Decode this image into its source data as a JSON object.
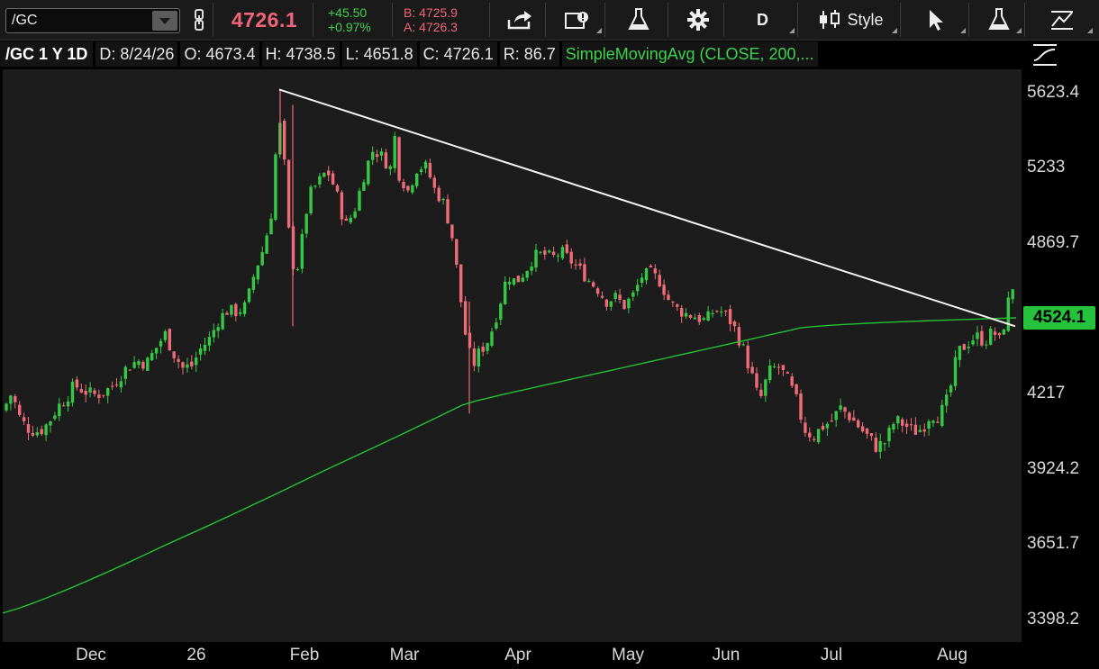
{
  "toolbar": {
    "symbol": "/GC",
    "last_price": "4726.1",
    "change": "+45.50",
    "change_pct": "+0.97%",
    "bid": "B: 4725.9",
    "ask": "A: 4726.3",
    "period_button": "D",
    "style_button": "Style"
  },
  "infobar": {
    "symbol_period": "/GC 1 Y 1D",
    "date": "D: 8/24/26",
    "open": "O: 4673.4",
    "high": "H: 4738.5",
    "low": "L: 4651.8",
    "close": "C: 4726.1",
    "range": "R: 86.7",
    "study": "SimpleMovingAvg (CLOSE, 200,..."
  },
  "chart_data": {
    "type": "candlestick",
    "overlays": [
      "SimpleMovingAvg (CLOSE, 200)",
      "trendline"
    ],
    "y_ticks": [
      "5623.4",
      "5233",
      "4869.7",
      "4524.1",
      "4217",
      "3924.2",
      "3651.7",
      "3398.2"
    ],
    "x_ticks": [
      "Dec",
      "26",
      "Feb",
      "Mar",
      "Apr",
      "May",
      "Jun",
      "Jul",
      "Aug"
    ],
    "current_sma_value": "4524.1",
    "trendline": {
      "from": [
        "Jan 28",
        5640
      ],
      "to": [
        "Aug 24",
        4490
      ]
    },
    "candles_close_path": [
      [
        0,
        4150
      ],
      [
        10,
        4220
      ],
      [
        20,
        4110
      ],
      [
        30,
        4080
      ],
      [
        40,
        4070
      ],
      [
        50,
        4100
      ],
      [
        60,
        4160
      ],
      [
        70,
        4200
      ],
      [
        80,
        4250
      ],
      [
        90,
        4230
      ],
      [
        100,
        4210
      ],
      [
        110,
        4220
      ],
      [
        120,
        4240
      ],
      [
        130,
        4290
      ],
      [
        140,
        4330
      ],
      [
        150,
        4350
      ],
      [
        160,
        4340
      ],
      [
        170,
        4400
      ],
      [
        180,
        4460
      ],
      [
        190,
        4380
      ],
      [
        200,
        4320
      ],
      [
        210,
        4330
      ],
      [
        220,
        4400
      ],
      [
        230,
        4440
      ],
      [
        240,
        4520
      ],
      [
        250,
        4560
      ],
      [
        260,
        4550
      ],
      [
        270,
        4580
      ],
      [
        280,
        4740
      ],
      [
        290,
        4850
      ],
      [
        300,
        5050
      ],
      [
        305,
        5480
      ],
      [
        310,
        5430
      ],
      [
        318,
        4900
      ],
      [
        325,
        4700
      ],
      [
        332,
        4880
      ],
      [
        340,
        5100
      ],
      [
        350,
        5160
      ],
      [
        360,
        5220
      ],
      [
        370,
        5120
      ],
      [
        380,
        4950
      ],
      [
        390,
        5020
      ],
      [
        400,
        5180
      ],
      [
        410,
        5320
      ],
      [
        420,
        5300
      ],
      [
        430,
        5220
      ],
      [
        435,
        5400
      ],
      [
        440,
        5200
      ],
      [
        450,
        5120
      ],
      [
        460,
        5230
      ],
      [
        470,
        5240
      ],
      [
        480,
        5120
      ],
      [
        490,
        5060
      ],
      [
        500,
        4880
      ],
      [
        508,
        4620
      ],
      [
        515,
        4420
      ],
      [
        522,
        4330
      ],
      [
        530,
        4390
      ],
      [
        540,
        4440
      ],
      [
        550,
        4560
      ],
      [
        560,
        4720
      ],
      [
        570,
        4690
      ],
      [
        580,
        4740
      ],
      [
        590,
        4810
      ],
      [
        600,
        4820
      ],
      [
        610,
        4800
      ],
      [
        620,
        4830
      ],
      [
        630,
        4790
      ],
      [
        640,
        4750
      ],
      [
        650,
        4700
      ],
      [
        660,
        4660
      ],
      [
        670,
        4600
      ],
      [
        680,
        4620
      ],
      [
        690,
        4580
      ],
      [
        700,
        4630
      ],
      [
        710,
        4720
      ],
      [
        720,
        4730
      ],
      [
        730,
        4690
      ],
      [
        740,
        4600
      ],
      [
        750,
        4560
      ],
      [
        760,
        4540
      ],
      [
        770,
        4530
      ],
      [
        780,
        4510
      ],
      [
        790,
        4560
      ],
      [
        800,
        4550
      ],
      [
        810,
        4500
      ],
      [
        820,
        4420
      ],
      [
        830,
        4310
      ],
      [
        840,
        4180
      ],
      [
        850,
        4300
      ],
      [
        860,
        4330
      ],
      [
        870,
        4280
      ],
      [
        880,
        4200
      ],
      [
        890,
        4080
      ],
      [
        900,
        4050
      ],
      [
        910,
        4090
      ],
      [
        920,
        4110
      ],
      [
        930,
        4160
      ],
      [
        940,
        4130
      ],
      [
        950,
        4090
      ],
      [
        960,
        4050
      ],
      [
        970,
        4010
      ],
      [
        980,
        4030
      ],
      [
        990,
        4110
      ],
      [
        1000,
        4100
      ],
      [
        1010,
        4070
      ],
      [
        1020,
        4080
      ],
      [
        1030,
        4140
      ],
      [
        1040,
        4130
      ],
      [
        1050,
        4200
      ],
      [
        1060,
        4380
      ],
      [
        1070,
        4420
      ],
      [
        1080,
        4450
      ],
      [
        1090,
        4430
      ],
      [
        1100,
        4470
      ],
      [
        1108,
        4420
      ],
      [
        1115,
        4580
      ],
      [
        1122,
        4680
      ],
      [
        1128,
        4726
      ]
    ]
  }
}
